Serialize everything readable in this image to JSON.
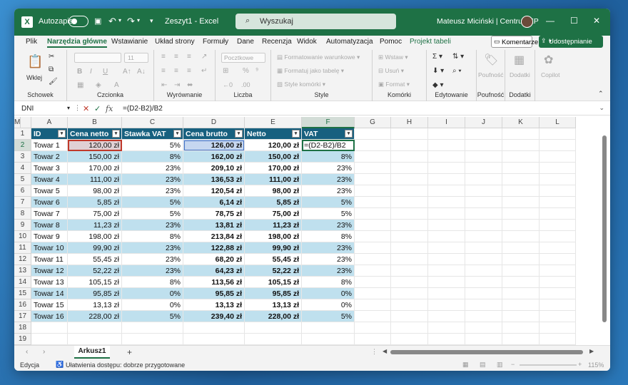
{
  "titlebar": {
    "app_logo": "X",
    "autosave_label": "Autozapis",
    "doc_title": "Zeszyt1 - Excel",
    "search_placeholder": "Wyszukaj",
    "user": "Mateusz Miciński | CentrumXP"
  },
  "menu": {
    "items": [
      "Plik",
      "Narzędzia główne",
      "Wstawianie",
      "Układ strony",
      "Formuły",
      "Dane",
      "Recenzja",
      "Widok",
      "Automatyzacja",
      "Pomoc",
      "Projekt tabeli"
    ],
    "comments": "Komentarze",
    "share": "Udostępnianie"
  },
  "ribbon": {
    "paste": "Wklej",
    "clipboard": "Schowek",
    "font_group": "Czcionka",
    "font_size": "11",
    "align_group": "Wyrównanie",
    "number_group": "Liczba",
    "number_format": "Pocztkowe",
    "styles_group": "Style",
    "cond_format": "Formatowanie warunkowe",
    "format_table": "Formatuj jako tabelę",
    "cell_styles": "Style komórki",
    "cells_group": "Komórki",
    "insert": "Wstaw",
    "delete": "Usuń",
    "format": "Format",
    "editing_group": "Edytowanie",
    "sensitivity": "Poufność",
    "sensitivity_group": "Poufność",
    "addins": "Dodatki",
    "addins_group": "Dodatki",
    "copilot": "Copilot"
  },
  "formula_bar": {
    "name_box": "DNI",
    "formula": "=(D2-B2)/B2"
  },
  "grid": {
    "columns": [
      "A",
      "B",
      "C",
      "D",
      "E",
      "F",
      "G",
      "H",
      "I",
      "J",
      "K",
      "L",
      "M"
    ],
    "headers": [
      "ID",
      "Cena netto",
      "Stawka VAT",
      "Cena brutto",
      "Netto",
      "VAT"
    ],
    "rows": [
      [
        "Towar 1",
        "120,00 zł",
        "5%",
        "126,00 zł",
        "120,00 zł",
        "=(D2-B2)/B2"
      ],
      [
        "Towar 2",
        "150,00 zł",
        "8%",
        "162,00 zł",
        "150,00 zł",
        "8%"
      ],
      [
        "Towar 3",
        "170,00 zł",
        "23%",
        "209,10 zł",
        "170,00 zł",
        "23%"
      ],
      [
        "Towar 4",
        "111,00 zł",
        "23%",
        "136,53 zł",
        "111,00 zł",
        "23%"
      ],
      [
        "Towar 5",
        "98,00 zł",
        "23%",
        "120,54 zł",
        "98,00 zł",
        "23%"
      ],
      [
        "Towar 6",
        "5,85 zł",
        "5%",
        "6,14 zł",
        "5,85 zł",
        "5%"
      ],
      [
        "Towar 7",
        "75,00 zł",
        "5%",
        "78,75 zł",
        "75,00 zł",
        "5%"
      ],
      [
        "Towar 8",
        "11,23 zł",
        "23%",
        "13,81 zł",
        "11,23 zł",
        "23%"
      ],
      [
        "Towar 9",
        "198,00 zł",
        "8%",
        "213,84 zł",
        "198,00 zł",
        "8%"
      ],
      [
        "Towar 10",
        "99,90 zł",
        "23%",
        "122,88 zł",
        "99,90 zł",
        "23%"
      ],
      [
        "Towar 11",
        "55,45 zł",
        "23%",
        "68,20 zł",
        "55,45 zł",
        "23%"
      ],
      [
        "Towar 12",
        "52,22 zł",
        "23%",
        "64,23 zł",
        "52,22 zł",
        "23%"
      ],
      [
        "Towar 13",
        "105,15 zł",
        "8%",
        "113,56 zł",
        "105,15 zł",
        "8%"
      ],
      [
        "Towar 14",
        "95,85 zł",
        "0%",
        "95,85 zł",
        "95,85 zł",
        "0%"
      ],
      [
        "Towar 15",
        "13,13 zł",
        "0%",
        "13,13 zł",
        "13,13 zł",
        "0%"
      ],
      [
        "Towar 16",
        "228,00 zł",
        "5%",
        "239,40 zł",
        "228,00 zł",
        "5%"
      ]
    ],
    "row_numbers": [
      "1",
      "2",
      "3",
      "4",
      "5",
      "6",
      "7",
      "8",
      "9",
      "10",
      "11",
      "12",
      "13",
      "14",
      "15",
      "16",
      "17",
      "18",
      "19"
    ]
  },
  "sheets": {
    "active": "Arkusz1"
  },
  "status": {
    "mode": "Edycja",
    "accessibility": "Ułatwienia dostępu: dobrze przygotowane",
    "zoom": "115%"
  },
  "colors": {
    "brand": "#1e7145",
    "table_header": "#17607f",
    "band": "#bfe0ee"
  }
}
